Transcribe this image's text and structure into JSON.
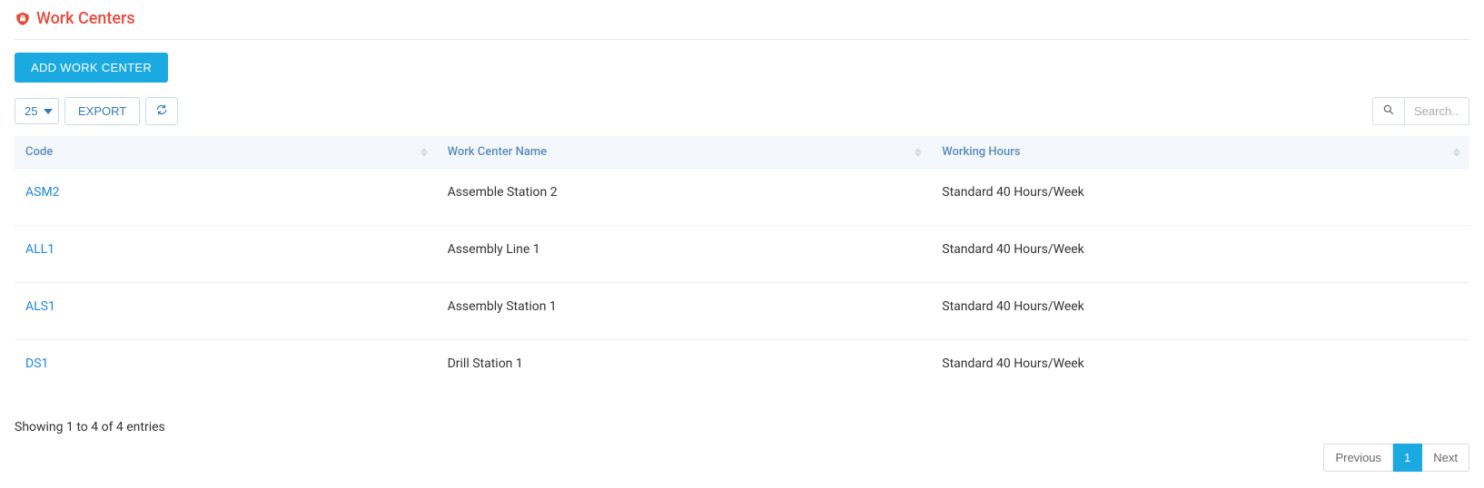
{
  "header": {
    "title": "Work Centers"
  },
  "actions": {
    "add_label": "ADD WORK CENTER"
  },
  "toolbar": {
    "page_size_value": "25",
    "export_label": "EXPORT"
  },
  "search": {
    "placeholder": "Search..."
  },
  "table": {
    "columns": [
      {
        "label": "Code"
      },
      {
        "label": "Work Center Name"
      },
      {
        "label": "Working Hours"
      }
    ],
    "rows": [
      {
        "code": "ASM2",
        "name": "Assemble Station 2",
        "hours": "Standard 40 Hours/Week"
      },
      {
        "code": "ALL1",
        "name": "Assembly Line 1",
        "hours": "Standard 40 Hours/Week"
      },
      {
        "code": "ALS1",
        "name": "Assembly Station 1",
        "hours": "Standard 40 Hours/Week"
      },
      {
        "code": "DS1",
        "name": "Drill Station 1",
        "hours": "Standard 40 Hours/Week"
      }
    ]
  },
  "footer": {
    "info_text": "Showing 1 to 4 of 4 entries"
  },
  "pagination": {
    "previous_label": "Previous",
    "page_label": "1",
    "next_label": "Next"
  }
}
